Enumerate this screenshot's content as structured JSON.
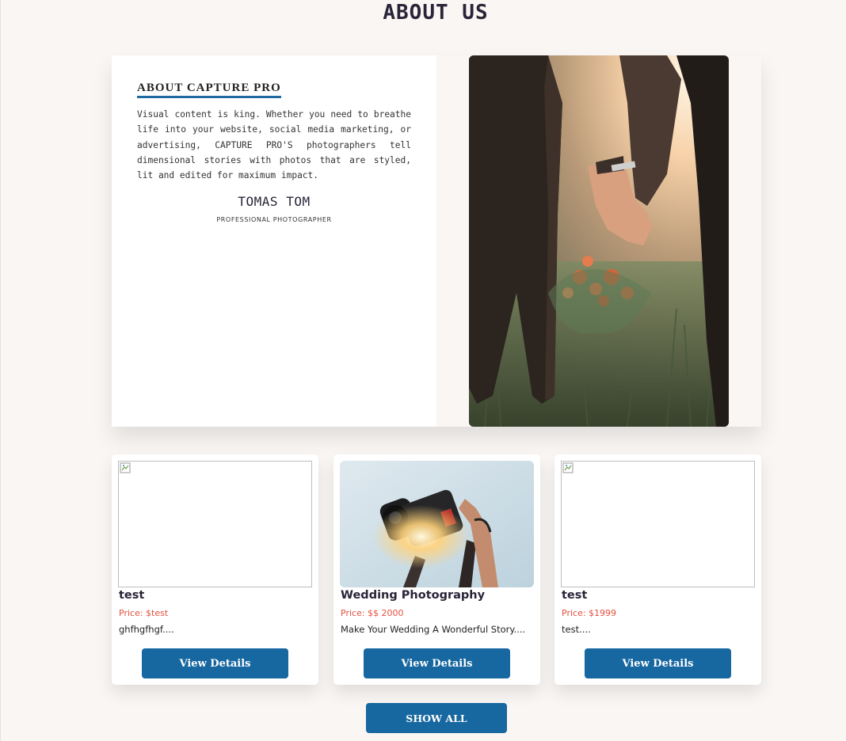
{
  "section": {
    "heading": "ABOUT US"
  },
  "about": {
    "title": "ABOUT CAPTURE PRO",
    "paragraph": "Visual content is king. Whether you need to breathe life into your website, social media marketing, or advertising, CAPTURE PRO'S photographers tell dimensional stories with photos that are styled, lit and edited for maximum impact.",
    "author_name": "TOMAS TOM",
    "author_role": "PROFESSIONAL PHOTOGRAPHER",
    "image": "couple-holding-hands-bouquet-photo"
  },
  "services": [
    {
      "title": "test",
      "price": "Price: $test",
      "description": "ghfhgfhgf....",
      "image": "broken-image-icon",
      "button": "View Details"
    },
    {
      "title": "Wedding Photography",
      "price": "Price: $$ 2000",
      "description": "Make Your Wedding A Wonderful Story....",
      "image": "camera-held-against-sky-photo",
      "button": "View Details"
    },
    {
      "title": "test",
      "price": "Price: $1999",
      "description": "test....",
      "image": "broken-image-icon",
      "button": "View Details"
    }
  ],
  "show_all_label": "SHOW ALL",
  "colors": {
    "page_background": "#f9f6f4",
    "button": "#1767a0",
    "price": "#e6503d",
    "title_underline": "#1f6aa0"
  }
}
